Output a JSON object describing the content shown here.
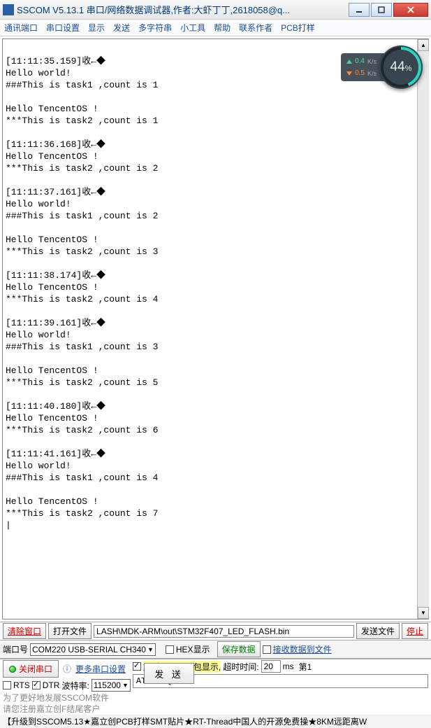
{
  "title": "SSCOM V5.13.1 串口/网络数据调试器,作者:大虾丁丁,2618058@q...",
  "menu": [
    "通讯端口",
    "串口设置",
    "显示",
    "发送",
    "多字符串",
    "小工具",
    "帮助",
    "联系作者",
    "PCB打样"
  ],
  "gauge": {
    "up_value": "0.4",
    "up_unit": "K/s",
    "down_value": "0.5",
    "down_unit": "K/s",
    "percent": "44",
    "percent_suffix": "%"
  },
  "console_lines": [
    "",
    "[11:11:35.159]收←◆",
    "Hello world!",
    "###This is task1 ,count is 1",
    "",
    "Hello TencentOS !",
    "***This is task2 ,count is 1",
    "",
    "[11:11:36.168]收←◆",
    "Hello TencentOS !",
    "***This is task2 ,count is 2",
    "",
    "[11:11:37.161]收←◆",
    "Hello world!",
    "###This is task1 ,count is 2",
    "",
    "Hello TencentOS !",
    "***This is task2 ,count is 3",
    "",
    "[11:11:38.174]收←◆",
    "Hello TencentOS !",
    "***This is task2 ,count is 4",
    "",
    "[11:11:39.161]收←◆",
    "Hello world!",
    "###This is task1 ,count is 3",
    "",
    "Hello TencentOS !",
    "***This is task2 ,count is 5",
    "",
    "[11:11:40.180]收←◆",
    "Hello TencentOS !",
    "***This is task2 ,count is 6",
    "",
    "[11:11:41.161]收←◆",
    "Hello world!",
    "###This is task1 ,count is 4",
    "",
    "Hello TencentOS !",
    "***This is task2 ,count is 7",
    "|"
  ],
  "buttons": {
    "clear": "清除窗口",
    "open_file": "打开文件",
    "send_file": "发送文件",
    "stop": "停止",
    "save_data": "保存数据",
    "recv_to_file": "接收数据到文件",
    "more_settings": "更多串口设置",
    "close_port": "关闭串口",
    "send": "发  送"
  },
  "labels": {
    "port": "端口号",
    "baud": "波特率:",
    "rts": "RTS",
    "dtr": "DTR",
    "hex_show": "HEX显示",
    "timestamp": "加时间戳和分包显示,",
    "timeout": "超时时间:",
    "ms": "ms",
    "line": "第1",
    "hint1": "为了更好地发展SSCOM软件",
    "hint2": "请您注册嘉立创F结尾客户"
  },
  "values": {
    "file_path": "LASH\\MDK-ARM\\out\\STM32F407_LED_FLASH.bin",
    "port_sel": "COM220 USB-SERIAL CH340",
    "baud_sel": "115200",
    "timeout_val": "20",
    "send_text": "AT+CESQ"
  },
  "footer": "【升级到SSCOM5.13★嘉立创PCB打样SMT贴片★RT-Thread中国人的开源免费操★8KM远距离W"
}
